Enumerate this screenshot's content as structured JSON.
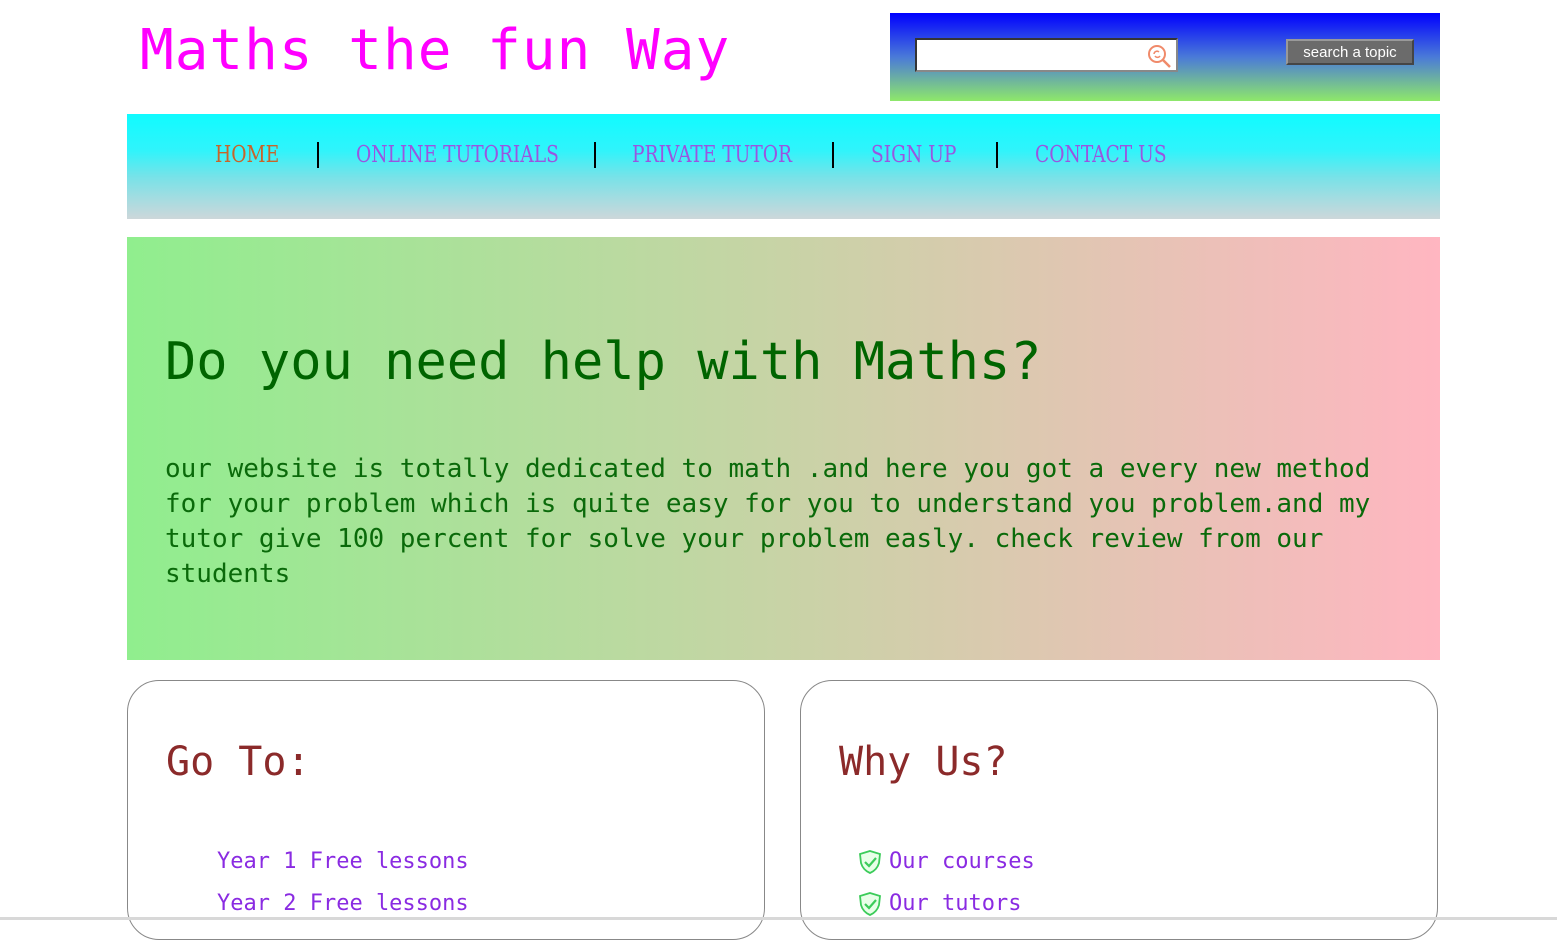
{
  "header": {
    "site_title": "Maths the fun Way"
  },
  "search": {
    "value": "",
    "button_label": "search a topic",
    "icon": "magnifier-icon"
  },
  "nav": {
    "items": [
      {
        "label": "HOME",
        "active": true
      },
      {
        "label": "ONLINE TUTORIALS",
        "active": false
      },
      {
        "label": "PRIVATE TUTOR",
        "active": false
      },
      {
        "label": "SIGN UP",
        "active": false
      },
      {
        "label": "CONTACT US",
        "active": false
      }
    ]
  },
  "hero": {
    "heading": "Do you need help with Maths?",
    "text": "our website is totally dedicated to math .and here you got a every new method for your problem which is quite easy for you to understand you problem.and my tutor give 100 percent for solve your problem easly. check review from our students"
  },
  "goto": {
    "title": "Go To:",
    "items": [
      "Year 1 Free lessons",
      "Year 2 Free lessons"
    ]
  },
  "why": {
    "title": "Why Us?",
    "items": [
      "Our courses",
      "Our tutors"
    ],
    "icon": "check-shield-icon"
  },
  "colors": {
    "title": "#ff00ff",
    "nav_active": "#c8642a",
    "nav_link": "#9a55e0",
    "hero_text": "#006400",
    "card_title": "#8b2a2a",
    "list_link": "#8a2be2"
  }
}
